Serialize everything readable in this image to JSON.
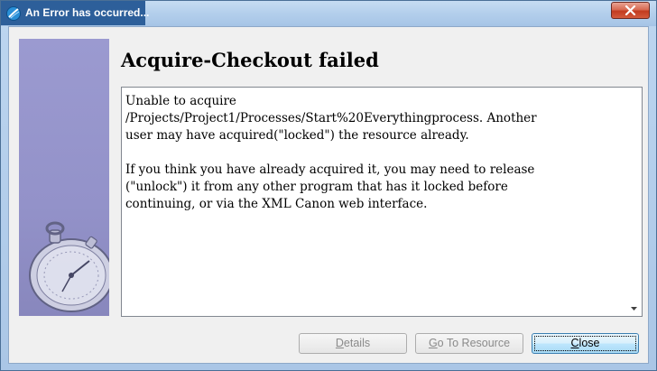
{
  "window": {
    "title": "An Error has occurred..."
  },
  "dialog": {
    "heading": "Acquire-Checkout failed",
    "message": "Unable to acquire\n/Projects/Project1/Processes/Start%20Everythingprocess. Another\nuser may have acquired(\"locked\") the resource already.\n\nIf you think you have already acquired it, you may need to release\n(\"unlock\") it from any other program that has it locked before\ncontinuing, or via the XML Canon web interface."
  },
  "buttons": {
    "details": {
      "mnemonic": "D",
      "rest": "etails",
      "enabled": false
    },
    "go_to_resource": {
      "mnemonic": "G",
      "rest": "o To Resource",
      "enabled": false
    },
    "close": {
      "mnemonic": "C",
      "rest": "lose",
      "enabled": true
    }
  },
  "icons": {
    "app": "app-logo-icon",
    "window_close": "close-icon",
    "scroll_down": "scroll-down-arrow-icon",
    "side_image": "stopwatch-image"
  },
  "colors": {
    "side_panel": "#9392c9",
    "title_block": "#2d5f9a",
    "close_button": "#c23b20"
  }
}
